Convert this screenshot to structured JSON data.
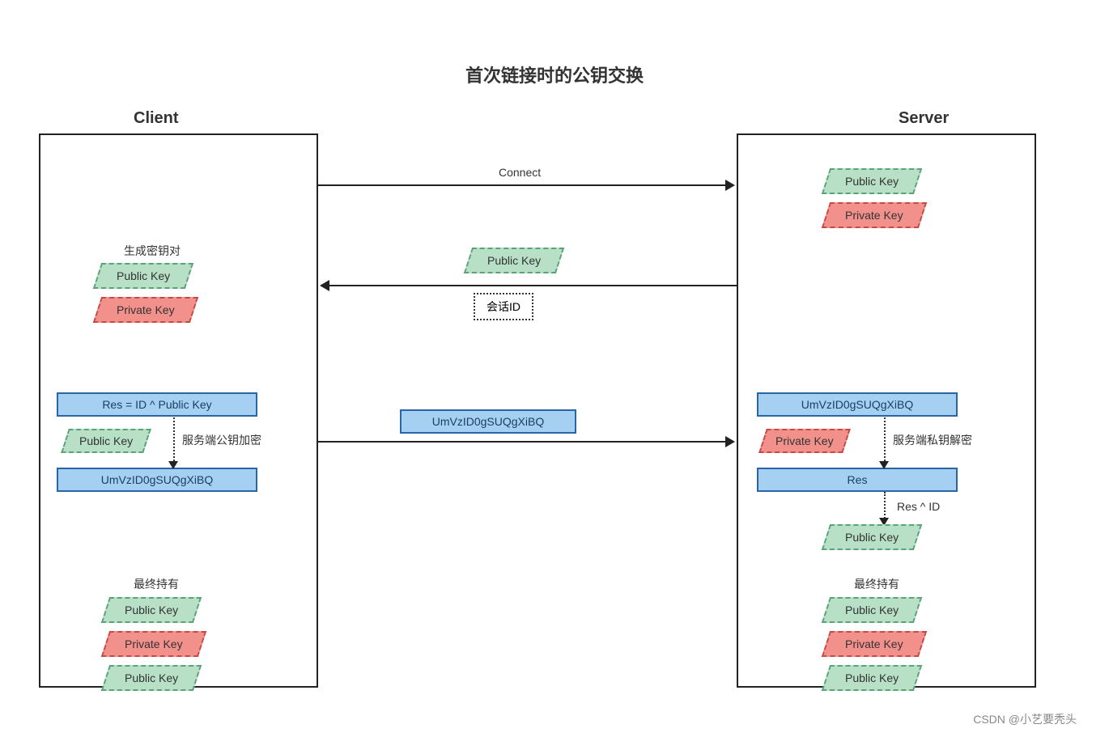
{
  "title": "首次链接时的公钥交换",
  "client_header": "Client",
  "server_header": "Server",
  "labels": {
    "public_key": "Public Key",
    "private_key": "Private Key",
    "gen_keypair": "生成密钥对",
    "session_id": "会话ID",
    "connect": "Connect",
    "res_formula": "Res = ID ^ Public Key",
    "encoded": "UmVzID0gSUQgXiBQ",
    "srv_pub_encrypt": "服务端公钥加密",
    "srv_priv_decrypt": "服务端私钥解密",
    "res": "Res",
    "res_xor_id": "Res ^ ID",
    "final_holds": "最终持有"
  },
  "watermark": "CSDN @小艺要秃头"
}
